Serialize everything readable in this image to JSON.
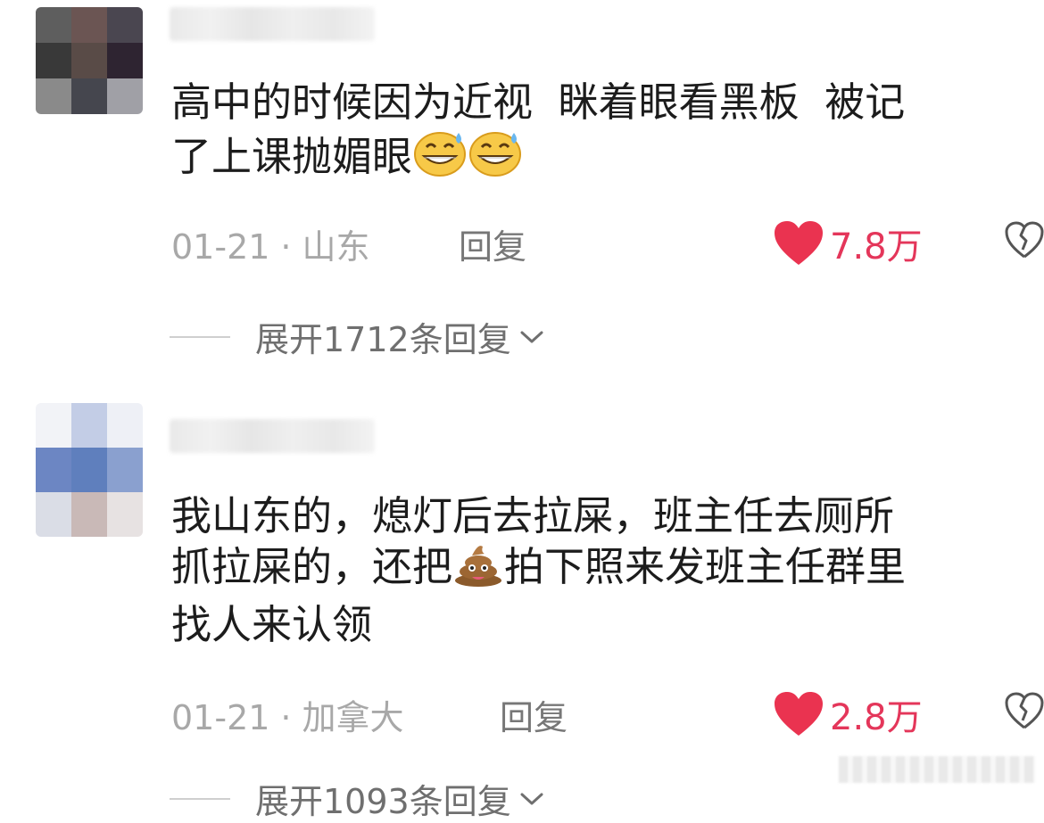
{
  "comments": [
    {
      "text_line1": "高中的时候因为近视  眯着眼看黑板  被记",
      "text_line2": "了上课抛媚眼",
      "emoji_1": "grinning-sweat-emoji",
      "emoji_2": "grinning-sweat-emoji",
      "date": "01-21",
      "separator": "·",
      "location": "山东",
      "reply_label": "回复",
      "like_count": "7.8万",
      "expand_label": "展开1712条回复"
    },
    {
      "text_line1": "我山东的，熄灯后去拉屎，班主任去厕所",
      "text_line2_part1": "抓拉屎的，还把",
      "text_line2_emoji": "poop-emoji",
      "text_line2_part2": "拍下照来发班主任群里",
      "text_line3": "找人来认领",
      "date": "01-21",
      "separator": "·",
      "location": "加拿大",
      "reply_label": "回复",
      "like_count": "2.8万",
      "expand_label": "展开1093条回复"
    }
  ],
  "colors": {
    "like": "#e4365a",
    "meta": "#a8a8a8",
    "text": "#1c1c1c"
  }
}
